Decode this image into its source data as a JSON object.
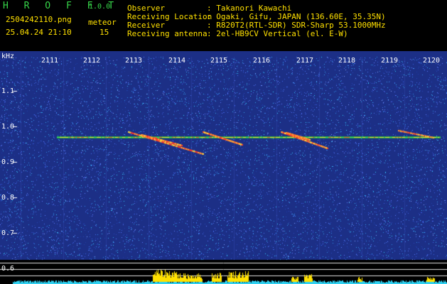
{
  "header": {
    "app_name": "H R O F F T",
    "version": "1.0.0",
    "filename": "2504242110.png",
    "datetime": "25.04.24 21:10",
    "meteor_label": "meteor",
    "meteor_count": "15",
    "info": [
      {
        "label": "Observer",
        "value": ": Takanori Kawachi"
      },
      {
        "label": "Receiving Location",
        "value": ": Ogaki, Gifu, JAPAN (136.60E, 35.35N)"
      },
      {
        "label": "Receiver",
        "value": ": R820T2(RTL-SDR) SDR-Sharp 53.1000MHz"
      },
      {
        "label": "Receiving antenna",
        "value": ": 2el-HB9CV Vertical (el. E-W)"
      }
    ]
  },
  "axis": {
    "unit": "kHz",
    "y_ticks": [
      "1.1",
      "1.0",
      "0.9",
      "0.8",
      "0.7",
      "0.6"
    ],
    "x_ticks": [
      "2111",
      "2112",
      "2113",
      "2114",
      "2115",
      "2116",
      "2117",
      "2118",
      "2119",
      "2120"
    ]
  },
  "colors": {
    "background": "#1c2f86",
    "carrier": "#ff3030",
    "level_fill": "#2fd0f0",
    "level_peak": "#ffe000",
    "grid": "#3d55c4"
  }
}
